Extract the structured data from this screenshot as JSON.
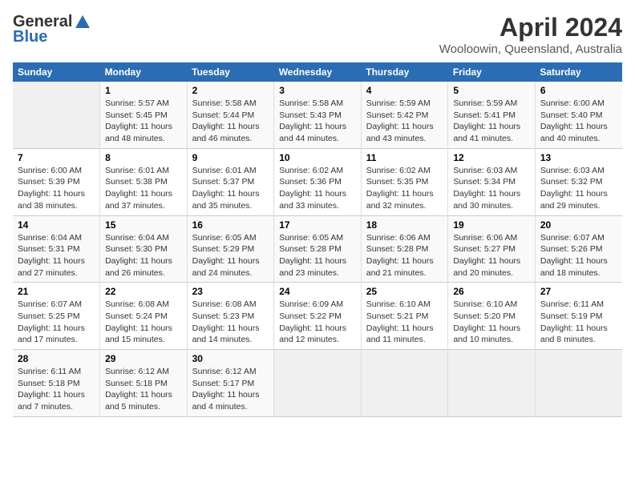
{
  "header": {
    "logo_general": "General",
    "logo_blue": "Blue",
    "month": "April 2024",
    "location": "Wooloowin, Queensland, Australia"
  },
  "weekdays": [
    "Sunday",
    "Monday",
    "Tuesday",
    "Wednesday",
    "Thursday",
    "Friday",
    "Saturday"
  ],
  "weeks": [
    [
      {
        "day": "",
        "empty": true
      },
      {
        "day": "1",
        "sunrise": "5:57 AM",
        "sunset": "5:45 PM",
        "daylight": "11 hours and 48 minutes."
      },
      {
        "day": "2",
        "sunrise": "5:58 AM",
        "sunset": "5:44 PM",
        "daylight": "11 hours and 46 minutes."
      },
      {
        "day": "3",
        "sunrise": "5:58 AM",
        "sunset": "5:43 PM",
        "daylight": "11 hours and 44 minutes."
      },
      {
        "day": "4",
        "sunrise": "5:59 AM",
        "sunset": "5:42 PM",
        "daylight": "11 hours and 43 minutes."
      },
      {
        "day": "5",
        "sunrise": "5:59 AM",
        "sunset": "5:41 PM",
        "daylight": "11 hours and 41 minutes."
      },
      {
        "day": "6",
        "sunrise": "6:00 AM",
        "sunset": "5:40 PM",
        "daylight": "11 hours and 40 minutes."
      }
    ],
    [
      {
        "day": "7",
        "sunrise": "6:00 AM",
        "sunset": "5:39 PM",
        "daylight": "11 hours and 38 minutes."
      },
      {
        "day": "8",
        "sunrise": "6:01 AM",
        "sunset": "5:38 PM",
        "daylight": "11 hours and 37 minutes."
      },
      {
        "day": "9",
        "sunrise": "6:01 AM",
        "sunset": "5:37 PM",
        "daylight": "11 hours and 35 minutes."
      },
      {
        "day": "10",
        "sunrise": "6:02 AM",
        "sunset": "5:36 PM",
        "daylight": "11 hours and 33 minutes."
      },
      {
        "day": "11",
        "sunrise": "6:02 AM",
        "sunset": "5:35 PM",
        "daylight": "11 hours and 32 minutes."
      },
      {
        "day": "12",
        "sunrise": "6:03 AM",
        "sunset": "5:34 PM",
        "daylight": "11 hours and 30 minutes."
      },
      {
        "day": "13",
        "sunrise": "6:03 AM",
        "sunset": "5:32 PM",
        "daylight": "11 hours and 29 minutes."
      }
    ],
    [
      {
        "day": "14",
        "sunrise": "6:04 AM",
        "sunset": "5:31 PM",
        "daylight": "11 hours and 27 minutes."
      },
      {
        "day": "15",
        "sunrise": "6:04 AM",
        "sunset": "5:30 PM",
        "daylight": "11 hours and 26 minutes."
      },
      {
        "day": "16",
        "sunrise": "6:05 AM",
        "sunset": "5:29 PM",
        "daylight": "11 hours and 24 minutes."
      },
      {
        "day": "17",
        "sunrise": "6:05 AM",
        "sunset": "5:28 PM",
        "daylight": "11 hours and 23 minutes."
      },
      {
        "day": "18",
        "sunrise": "6:06 AM",
        "sunset": "5:28 PM",
        "daylight": "11 hours and 21 minutes."
      },
      {
        "day": "19",
        "sunrise": "6:06 AM",
        "sunset": "5:27 PM",
        "daylight": "11 hours and 20 minutes."
      },
      {
        "day": "20",
        "sunrise": "6:07 AM",
        "sunset": "5:26 PM",
        "daylight": "11 hours and 18 minutes."
      }
    ],
    [
      {
        "day": "21",
        "sunrise": "6:07 AM",
        "sunset": "5:25 PM",
        "daylight": "11 hours and 17 minutes."
      },
      {
        "day": "22",
        "sunrise": "6:08 AM",
        "sunset": "5:24 PM",
        "daylight": "11 hours and 15 minutes."
      },
      {
        "day": "23",
        "sunrise": "6:08 AM",
        "sunset": "5:23 PM",
        "daylight": "11 hours and 14 minutes."
      },
      {
        "day": "24",
        "sunrise": "6:09 AM",
        "sunset": "5:22 PM",
        "daylight": "11 hours and 12 minutes."
      },
      {
        "day": "25",
        "sunrise": "6:10 AM",
        "sunset": "5:21 PM",
        "daylight": "11 hours and 11 minutes."
      },
      {
        "day": "26",
        "sunrise": "6:10 AM",
        "sunset": "5:20 PM",
        "daylight": "11 hours and 10 minutes."
      },
      {
        "day": "27",
        "sunrise": "6:11 AM",
        "sunset": "5:19 PM",
        "daylight": "11 hours and 8 minutes."
      }
    ],
    [
      {
        "day": "28",
        "sunrise": "6:11 AM",
        "sunset": "5:18 PM",
        "daylight": "11 hours and 7 minutes."
      },
      {
        "day": "29",
        "sunrise": "6:12 AM",
        "sunset": "5:18 PM",
        "daylight": "11 hours and 5 minutes."
      },
      {
        "day": "30",
        "sunrise": "6:12 AM",
        "sunset": "5:17 PM",
        "daylight": "11 hours and 4 minutes."
      },
      {
        "day": "",
        "empty": true
      },
      {
        "day": "",
        "empty": true
      },
      {
        "day": "",
        "empty": true
      },
      {
        "day": "",
        "empty": true
      }
    ]
  ]
}
